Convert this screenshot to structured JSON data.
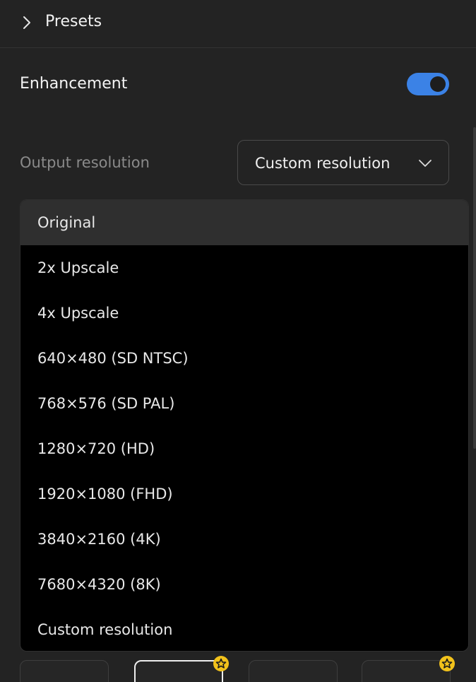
{
  "presets": {
    "title": "Presets",
    "icon": "chevron-right-icon"
  },
  "enhancement": {
    "label": "Enhancement",
    "toggle_on": true,
    "toggle_color": "#3b82e6"
  },
  "output_resolution": {
    "label": "Output resolution",
    "selected": "Custom resolution",
    "options": [
      "Original",
      "2x Upscale",
      "4x Upscale",
      "640×480 (SD NTSC)",
      "768×576 (SD PAL)",
      "1280×720 (HD)",
      "1920×1080 (FHD)",
      "3840×2160 (4K)",
      "7680×4320 (8K)",
      "Custom resolution"
    ],
    "highlighted": "Original"
  },
  "thumbnails": [
    {
      "premium": false,
      "selected": false
    },
    {
      "premium": true,
      "selected": true
    },
    {
      "premium": false,
      "selected": false
    },
    {
      "premium": true,
      "selected": false
    }
  ],
  "colors": {
    "background": "#232323",
    "accent": "#3b82e6",
    "premium_badge": "#f2c21b"
  }
}
